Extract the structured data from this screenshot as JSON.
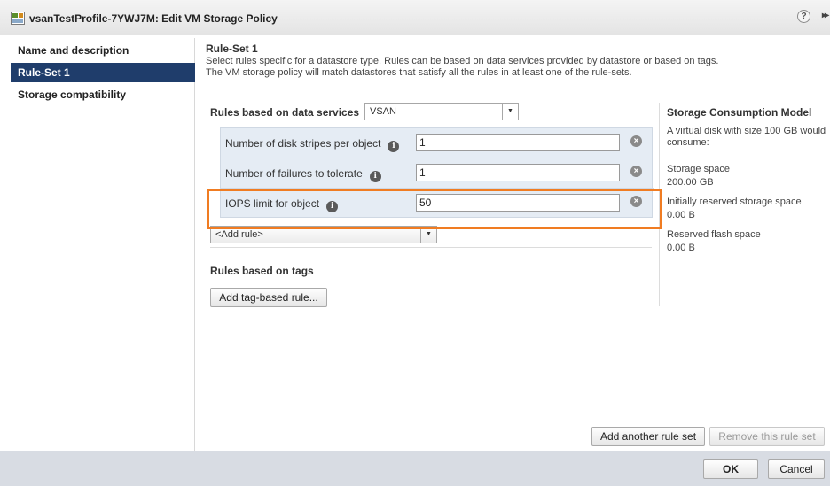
{
  "window": {
    "title": "vsanTestProfile-7YWJ7M: Edit VM Storage Policy",
    "help": "?",
    "expand": "▸▸"
  },
  "sidebar": {
    "items": [
      {
        "label": "Name and description"
      },
      {
        "label": "Rule-Set 1",
        "active": true
      },
      {
        "label": "Storage compatibility"
      }
    ]
  },
  "main": {
    "title": "Rule-Set 1",
    "description_line1": "Select rules specific for a datastore type. Rules can be based on data services provided by datastore or based on tags.",
    "description_line2": "The VM storage policy will match datastores that satisfy all the rules in at least one of the rule-sets.",
    "data_services": {
      "label": "Rules based on data services",
      "selected": "VSAN"
    },
    "rules": [
      {
        "label": "Number of disk stripes per object",
        "value": "1"
      },
      {
        "label": "Number of failures to tolerate",
        "value": "1"
      },
      {
        "label": "IOPS limit for object",
        "value": "50",
        "highlighted": true
      }
    ],
    "add_rule": "<Add rule>",
    "tags": {
      "label": "Rules based on tags",
      "button": "Add tag-based rule..."
    },
    "add_rule_set": "Add another rule set",
    "remove_rule_set": "Remove this rule set"
  },
  "consumption": {
    "title": "Storage Consumption Model",
    "intro": "A virtual disk with size 100 GB would consume:",
    "storage_space_label": "Storage space",
    "storage_space_value": "200.00 GB",
    "reserved_label": "Initially reserved storage space",
    "reserved_value": "0.00 B",
    "flash_label": "Reserved flash space",
    "flash_value": "0.00 B"
  },
  "footer": {
    "ok": "OK",
    "cancel": "Cancel"
  },
  "colors": {
    "highlight": "#f07c22",
    "active_nav": "#1f3d6b",
    "rules_panel": "#e5ecf4"
  }
}
